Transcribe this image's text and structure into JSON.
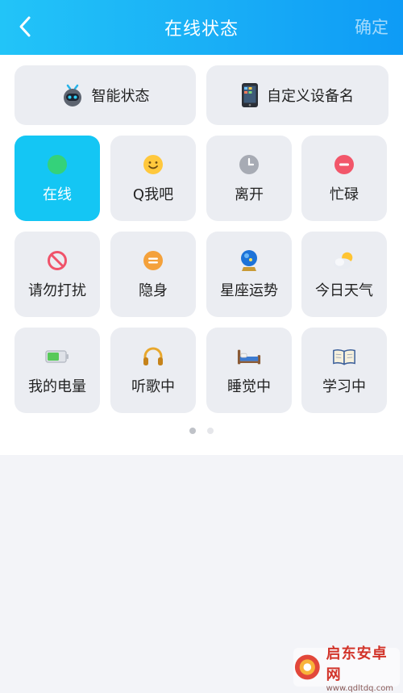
{
  "header": {
    "title": "在线状态",
    "confirm_label": "确定"
  },
  "top_cards": [
    {
      "label": "智能状态",
      "icon": "robot-icon"
    },
    {
      "label": "自定义设备名",
      "icon": "phone-icon"
    }
  ],
  "statuses": [
    {
      "label": "在线",
      "icon": "online-dot-icon",
      "selected": true
    },
    {
      "label": "Q我吧",
      "icon": "smiley-icon"
    },
    {
      "label": "离开",
      "icon": "clock-icon"
    },
    {
      "label": "忙碌",
      "icon": "busy-icon"
    },
    {
      "label": "请勿打扰",
      "icon": "do-not-disturb-icon"
    },
    {
      "label": "隐身",
      "icon": "invisible-icon"
    },
    {
      "label": "星座运势",
      "icon": "crystal-ball-icon"
    },
    {
      "label": "今日天气",
      "icon": "weather-icon"
    },
    {
      "label": "我的电量",
      "icon": "battery-icon"
    },
    {
      "label": "听歌中",
      "icon": "headphones-icon"
    },
    {
      "label": "睡觉中",
      "icon": "bed-icon"
    },
    {
      "label": "学习中",
      "icon": "book-icon"
    }
  ],
  "pagination": {
    "current": 1,
    "total": 2
  },
  "colors": {
    "header_start": "#22c4f8",
    "header_end": "#0e9bf6",
    "selected_tile": "#14c6f4",
    "tile_bg": "#ebedf2"
  },
  "watermark": {
    "title": "启东安卓网",
    "url": "www.qdltdq.com"
  }
}
